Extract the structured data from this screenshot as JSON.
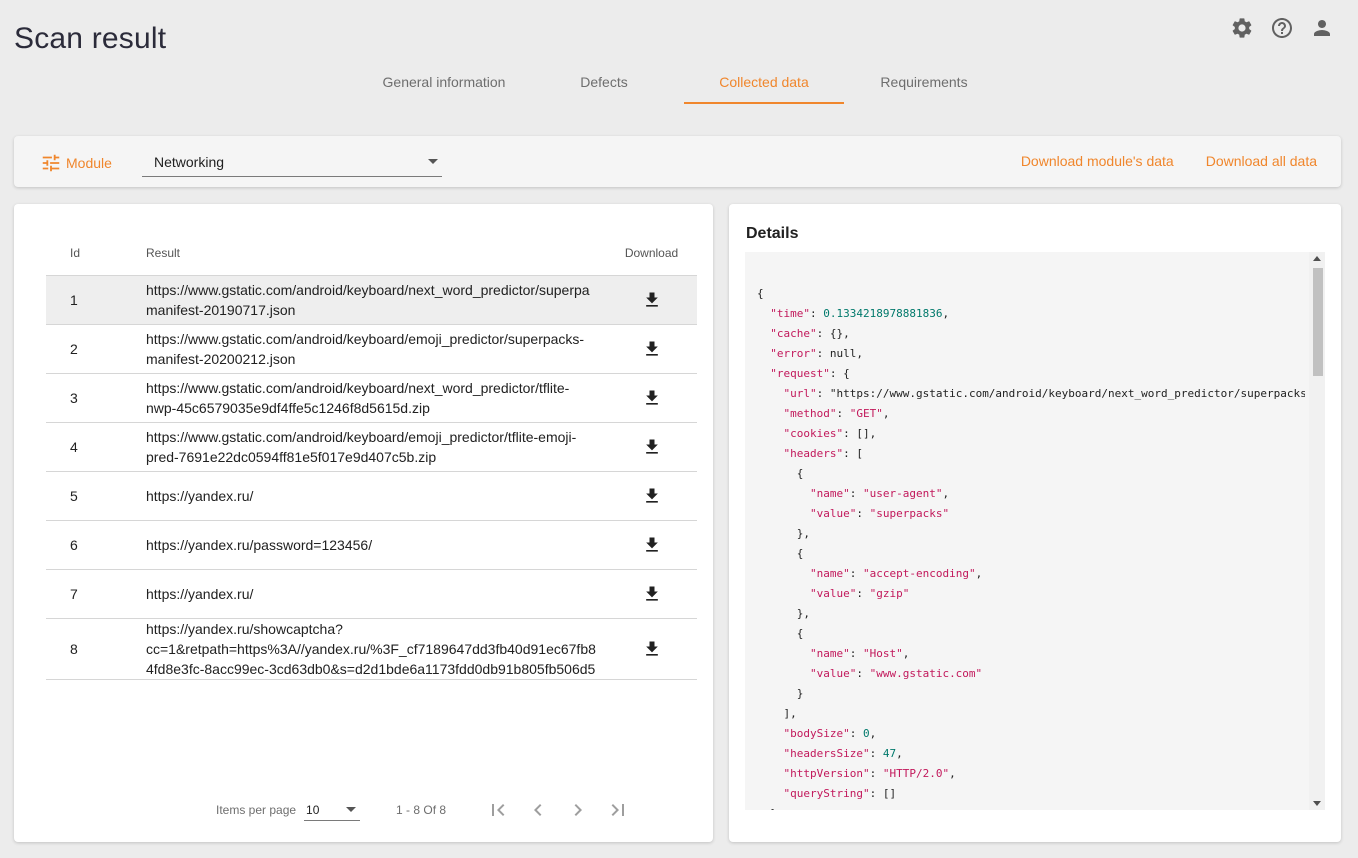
{
  "page": {
    "title": "Scan result"
  },
  "top_icons": [
    "gear-icon",
    "help-circle-icon",
    "account-icon"
  ],
  "tabs": [
    {
      "label": "General information",
      "active": false
    },
    {
      "label": "Defects",
      "active": false
    },
    {
      "label": "Collected data",
      "active": true
    },
    {
      "label": "Requirements",
      "active": false
    }
  ],
  "toolbar": {
    "module_label": "Module",
    "module_value": "Networking",
    "download_module": "Download module's data",
    "download_all": "Download all data"
  },
  "table": {
    "headers": {
      "id": "Id",
      "result": "Result",
      "download": "Download"
    },
    "rows": [
      {
        "id": "1",
        "result": "https://www.gstatic.com/android/keyboard/next_word_predictor/superpa\nmanifest-20190717.json"
      },
      {
        "id": "2",
        "result": "https://www.gstatic.com/android/keyboard/emoji_predictor/superpacks-\nmanifest-20200212.json"
      },
      {
        "id": "3",
        "result": "https://www.gstatic.com/android/keyboard/next_word_predictor/tflite-\nnwp-45c6579035e9df4ffe5c1246f8d5615d.zip"
      },
      {
        "id": "4",
        "result": "https://www.gstatic.com/android/keyboard/emoji_predictor/tflite-emoji-\npred-7691e22dc0594ff81e5f017e9d407c5b.zip"
      },
      {
        "id": "5",
        "result": "https://yandex.ru/"
      },
      {
        "id": "6",
        "result": "https://yandex.ru/password=123456/"
      },
      {
        "id": "7",
        "result": "https://yandex.ru/"
      },
      {
        "id": "8",
        "result": "https://yandex.ru/showcaptcha?\ncc=1&retpath=https%3A//yandex.ru/%3F_cf7189647dd3fb40d91ec67fb8\n4fd8e3fc-8acc99ec-3cd63db0&s=d2d1bde6a1173fdd0db91b805fb506d5"
      }
    ]
  },
  "pagination": {
    "items_per_page_label": "Items per page",
    "items_per_page": "10",
    "range": "1 - 8 Of 8"
  },
  "details": {
    "title": "Details",
    "json_lines": [
      "{",
      "  \"time\": 0.1334218978881836,",
      "  \"cache\": {},",
      "  \"error\": null,",
      "  \"request\": {",
      "    \"url\": \"https://www.gstatic.com/android/keyboard/next_word_predictor/superpacks",
      "    \"method\": \"GET\",",
      "    \"cookies\": [],",
      "    \"headers\": [",
      "      {",
      "        \"name\": \"user-agent\",",
      "        \"value\": \"superpacks\"",
      "      },",
      "      {",
      "        \"name\": \"accept-encoding\",",
      "        \"value\": \"gzip\"",
      "      },",
      "      {",
      "        \"name\": \"Host\",",
      "        \"value\": \"www.gstatic.com\"",
      "      }",
      "    ],",
      "    \"bodySize\": 0,",
      "    \"headersSize\": 47,",
      "    \"httpVersion\": \"HTTP/2.0\",",
      "    \"queryString\": []",
      "  },"
    ]
  },
  "colors": {
    "accent": "#f0862c",
    "background": "#ececec",
    "json_key": "#c2185b",
    "json_number": "#00796b"
  }
}
